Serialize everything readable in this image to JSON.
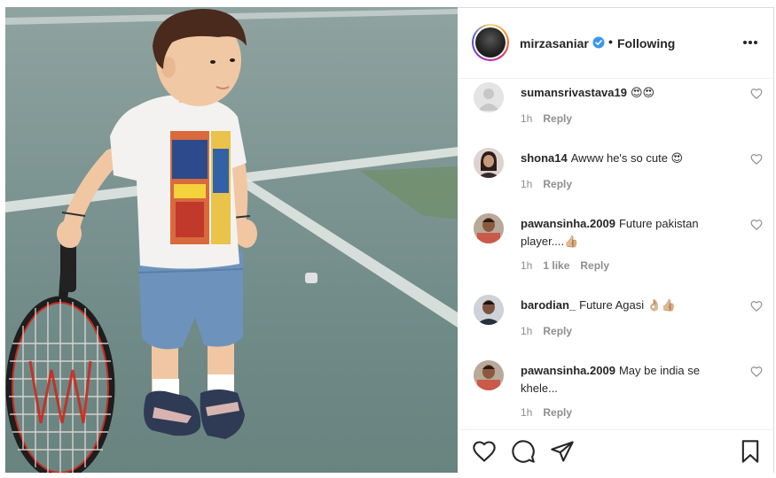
{
  "post": {
    "photo_description_icon": "photo-icon"
  },
  "header": {
    "username": "mirzasaniar",
    "separator": "•",
    "follow_state": "Following",
    "more_icon": "more-horizontal-icon",
    "verified_icon": "verified-badge-icon",
    "verified_color": "#3897f0"
  },
  "comments": [
    {
      "user": "sumansrivastava19",
      "text": "😍😍",
      "time": "1h",
      "likes": "",
      "reply": "Reply"
    },
    {
      "user": "shona14",
      "text": "Awww he's so cute 😍",
      "time": "1h",
      "likes": "",
      "reply": "Reply"
    },
    {
      "user": "pawansinha.2009",
      "text": "Future pakistan player....👍🏼",
      "time": "1h",
      "likes": "1 like",
      "reply": "Reply"
    },
    {
      "user": "barodian_",
      "text": "Future Agasi 👌🏼👍🏼",
      "time": "1h",
      "likes": "",
      "reply": "Reply"
    },
    {
      "user": "pawansinha.2009",
      "text": "May be india se khele...",
      "time": "1h",
      "likes": "",
      "reply": "Reply"
    }
  ],
  "actions": {
    "like_icon": "heart-icon",
    "comment_icon": "comment-icon",
    "share_icon": "send-icon",
    "save_icon": "bookmark-icon"
  }
}
